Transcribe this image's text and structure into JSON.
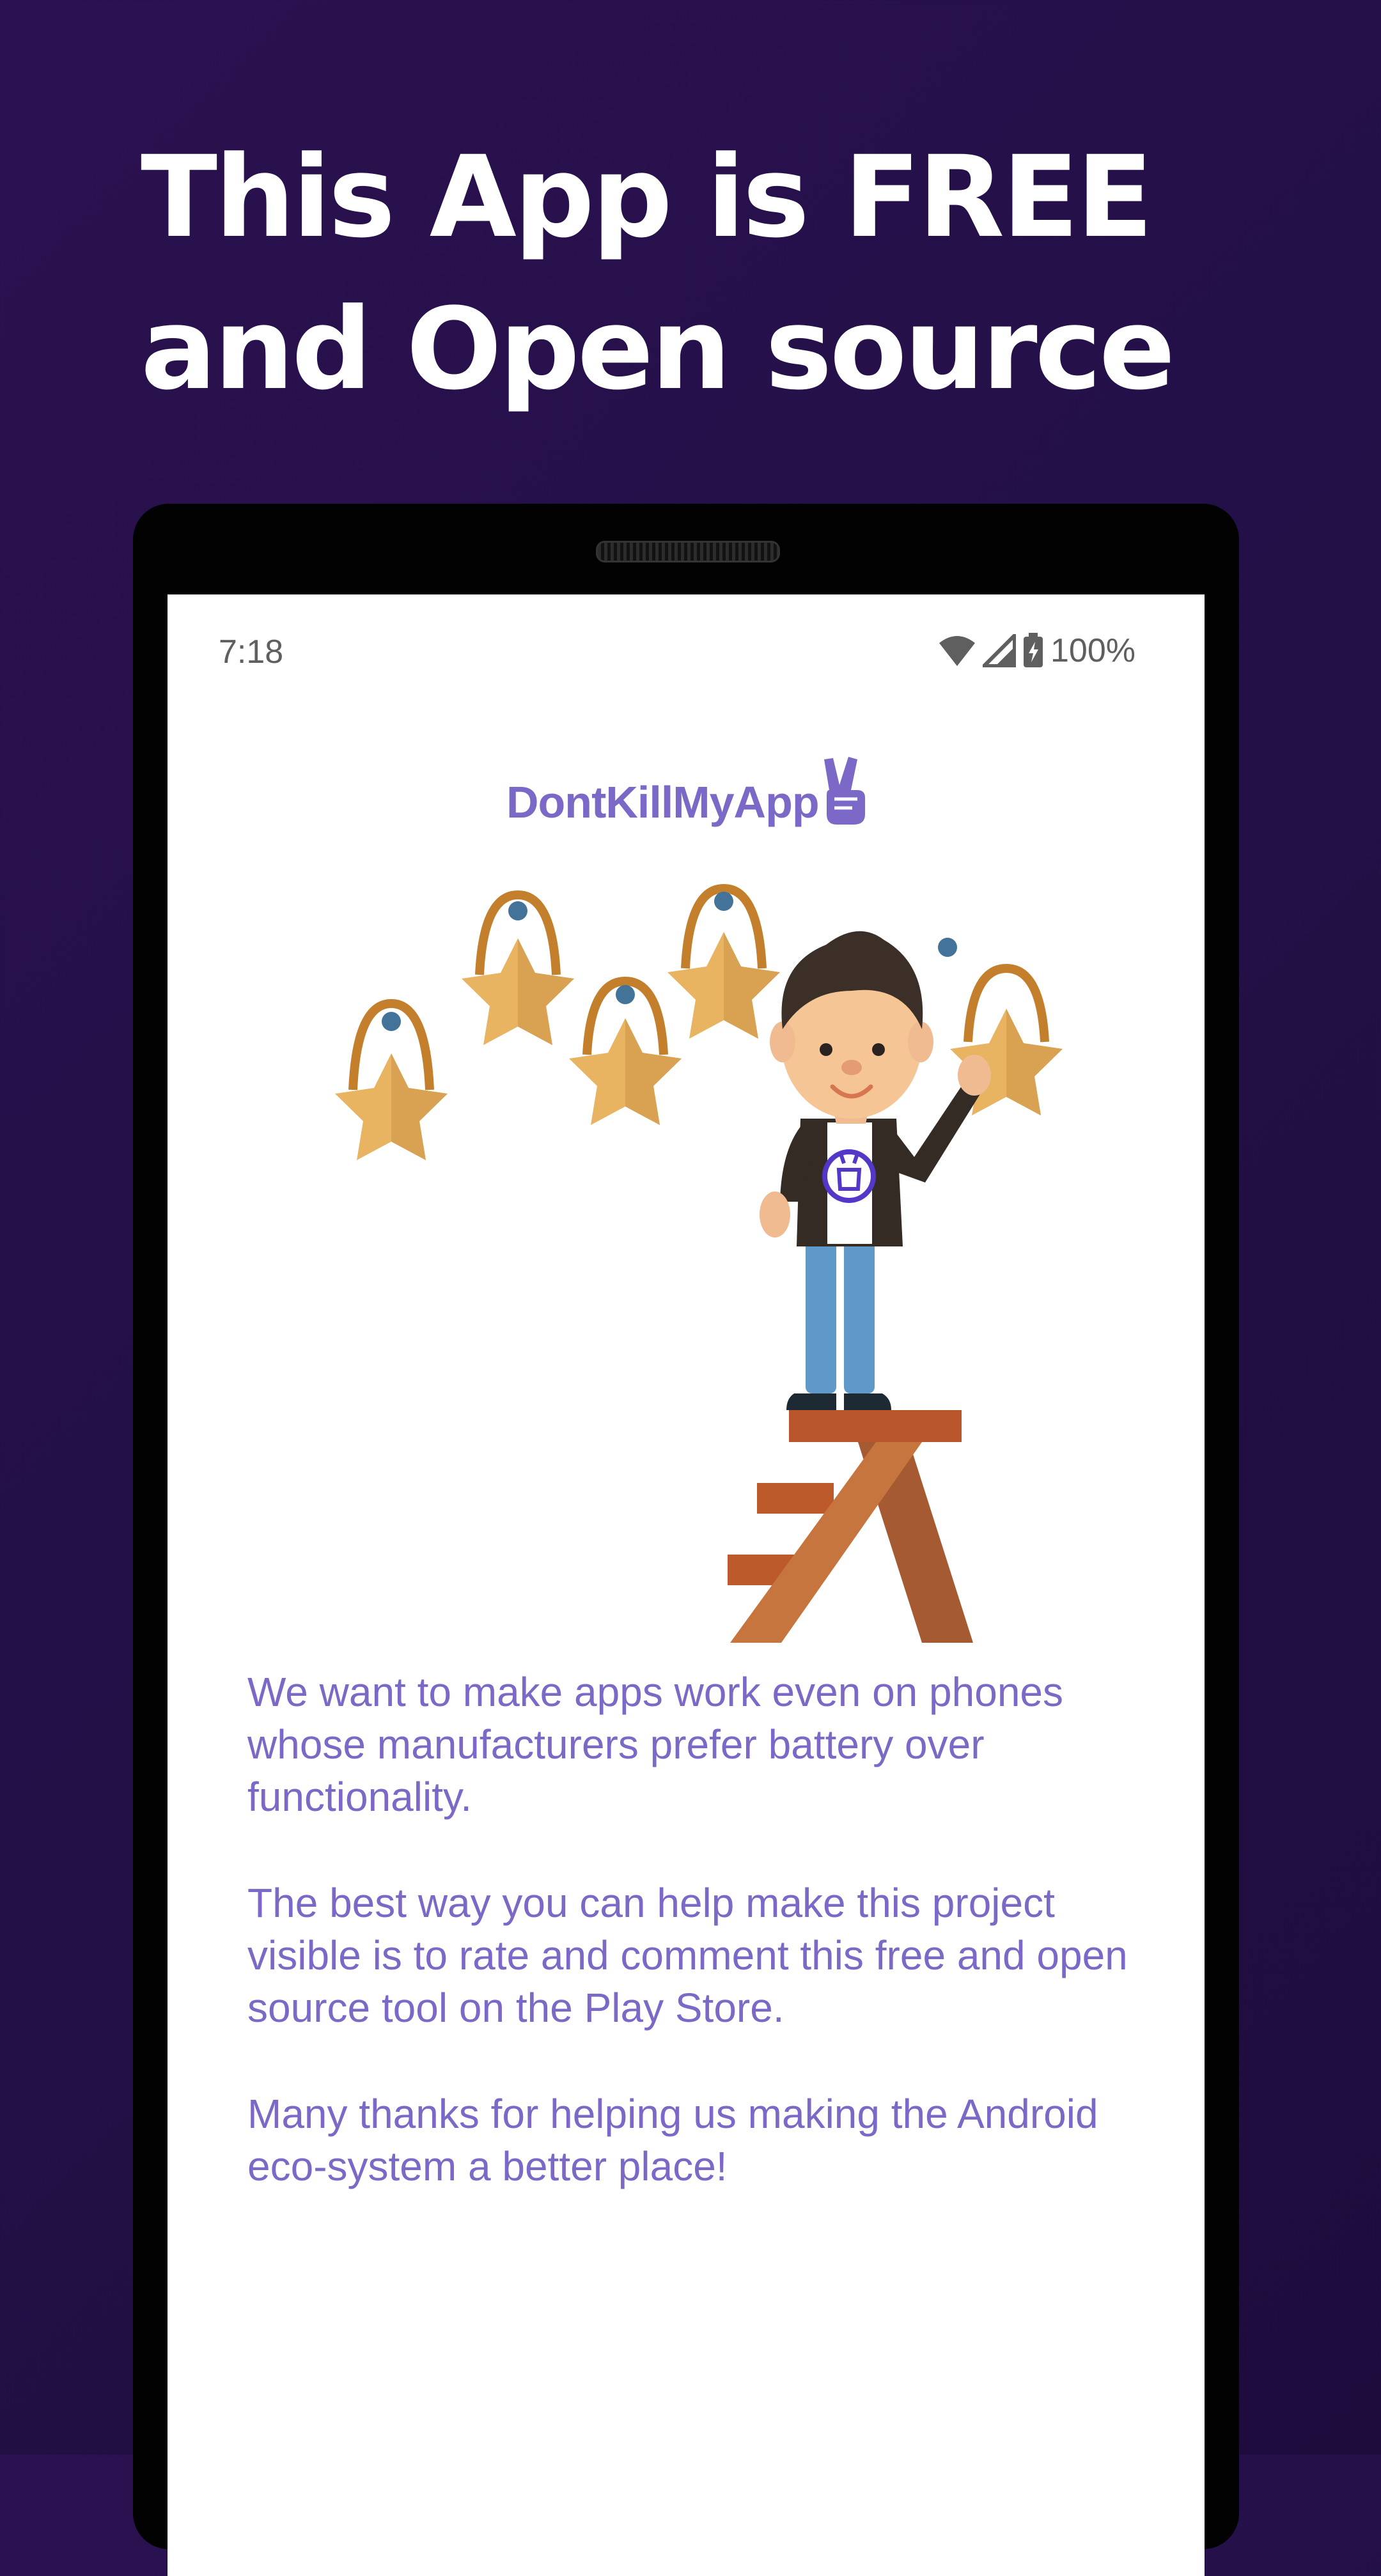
{
  "headline": "This App is FREE and Open source",
  "status_bar": {
    "time": "7:18",
    "battery": "100%",
    "icons": [
      "wifi-icon",
      "signal-icon",
      "battery-charging-icon"
    ]
  },
  "app": {
    "logo_text": "DontKillMyApp",
    "logo_icon": "peace-hand-icon"
  },
  "illustration": {
    "name": "person-on-ladder-with-stars",
    "star_count": 5
  },
  "paragraphs": [
    "We want to make apps work even on phones whose manufacturers prefer battery over functionality.",
    "The best way you can help make this project visible is to rate and comment this free and open source tool on the Play Store.",
    "Many thanks for helping us making the Android eco-system a better place!"
  ],
  "colors": {
    "background": "#231048",
    "accent": "#7b68c7",
    "star": "#e8b462",
    "star_hook": "#c47f2c",
    "ladder": "#c0612f"
  }
}
